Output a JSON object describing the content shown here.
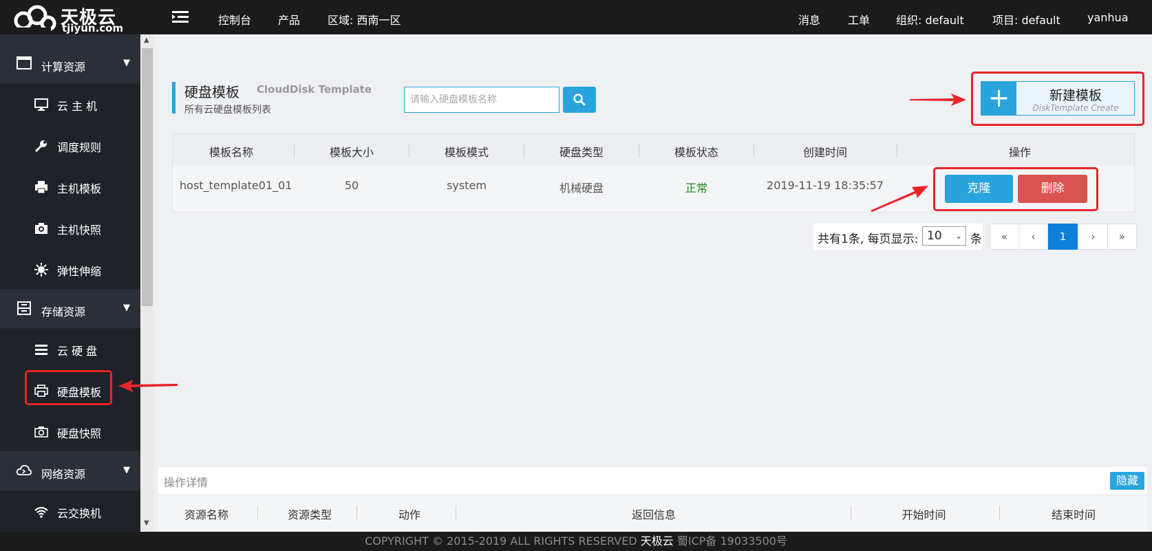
{
  "topbar": {
    "brand": "天极云",
    "domain": "tjiyun.com",
    "nav": [
      "控制台",
      "产品",
      "区域: 西南一区"
    ],
    "right": [
      "消息",
      "工单",
      "组织: default",
      "项目: default",
      "yanhua"
    ]
  },
  "sidebar": {
    "groups": [
      {
        "label": "计算资源",
        "icon": "window-icon",
        "items": [
          {
            "label": "云 主 机",
            "icon": "monitor-icon"
          },
          {
            "label": "调度规则",
            "icon": "wrench-icon"
          },
          {
            "label": "主机模板",
            "icon": "printer-icon"
          },
          {
            "label": "主机快照",
            "icon": "camera-icon"
          },
          {
            "label": "弹性伸缩",
            "icon": "sun-icon"
          }
        ]
      },
      {
        "label": "存储资源",
        "icon": "storage-icon",
        "items": [
          {
            "label": "云 硬 盘",
            "icon": "list-icon"
          },
          {
            "label": "硬盘模板",
            "icon": "printer-icon"
          },
          {
            "label": "硬盘快照",
            "icon": "camera-icon"
          }
        ]
      },
      {
        "label": "网络资源",
        "icon": "cloud-icon",
        "items": [
          {
            "label": "云交换机",
            "icon": "wifi-icon"
          }
        ]
      }
    ]
  },
  "page": {
    "title": "硬盘模板",
    "title_en": "CloudDisk Template",
    "subtitle": "所有云硬盘模板列表",
    "search_placeholder": "请输入硬盘模板名称",
    "create_label": "新建模板",
    "create_sublabel": "DiskTemplate Create"
  },
  "table": {
    "columns": [
      "模板名称",
      "模板大小",
      "模板模式",
      "硬盘类型",
      "模板状态",
      "创建时间",
      "操作"
    ],
    "rows": [
      {
        "name": "host_template01_01",
        "size": "50",
        "mode": "system",
        "disk_type": "机械硬盘",
        "status": "正常",
        "created": "2019-11-19 18:35:57",
        "clone": "克隆",
        "delete": "删除"
      }
    ],
    "status_color": "#1c8a1c"
  },
  "pager": {
    "total_text": "共有1条, 每页显示:",
    "page_size": "10",
    "unit": "条",
    "buttons": [
      "«",
      "‹",
      "1",
      "›",
      "»"
    ]
  },
  "detail": {
    "title": "操作详情",
    "hide_label": "隐藏",
    "columns": [
      "资源名称",
      "资源类型",
      "动作",
      "返回信息",
      "开始时间",
      "结束时间"
    ]
  },
  "footer": {
    "copyright": "COPYRIGHT © 2015-2019 ALL RIGHTS RESERVED",
    "brand": "天极云",
    "icp": "蜀ICP备 19033500号"
  },
  "colors": {
    "accent": "#2aa4dc",
    "danger": "#d9534f",
    "annotation": "#e8232a",
    "sidebar": "#2b3038"
  }
}
